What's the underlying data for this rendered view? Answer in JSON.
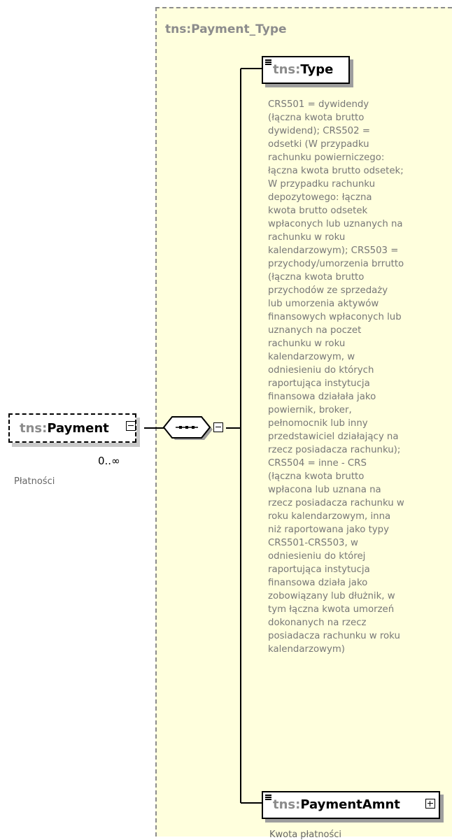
{
  "complex_type": {
    "title": "tns:Payment_Type"
  },
  "root_element": {
    "prefix": "tns:",
    "name": "Payment",
    "occurrence": "0..∞",
    "annotation": "Płatności"
  },
  "sequence_compositor": {
    "icon": "sequence-icon",
    "collapse_icon": "minus-icon"
  },
  "children": [
    {
      "prefix": "tns:",
      "name": "Type",
      "annotation_lines": [
        "CRS501 = dywidendy",
        "(łączna kwota brutto",
        "dywidend); CRS502 =",
        "odsetki (W przypadku",
        "rachunku powierniczego:",
        "łączna kwota brutto odsetek;",
        "W przypadku rachunku",
        "depozytowego: łączna",
        "kwota brutto odsetek",
        "wpłaconych lub uznanych na",
        "rachunku w roku",
        "kalendarzowym); CRS503 =",
        "przychody/umorzenia brrutto",
        "(łączna kwota brutto",
        "przychodów ze sprzedaży",
        "lub umorzenia aktywów",
        "finansowych wpłaconych lub",
        "uznanych na poczet",
        "rachunku w roku",
        "kalendarzowym, w",
        "odniesieniu do których",
        "raportująca instytucja",
        "finansowa działała jako",
        "powiernik, broker,",
        "pełnomocnik lub inny",
        "przedstawiciel działający na",
        "rzecz posiadacza rachunku);",
        "CRS504 = inne - CRS",
        "(łączna kwota brutto",
        "wpłacona lub uznana na",
        "rzecz posiadacza rachunku w",
        "roku kalendarzowym, inna",
        "niż raportowana jako typy",
        "CRS501-CRS503, w",
        "odniesieniu do której",
        "raportująca instytucja",
        "finansowa działa jako",
        "zobowiązany lub dłużnik, w",
        "tym łączna kwota umorzeń",
        "dokonanych na rzecz",
        "posiadacza rachunku w roku",
        "kalendarzowym)"
      ]
    },
    {
      "prefix": "tns:",
      "name": "PaymentAmnt",
      "annotation": "Kwota płatności",
      "expand_icon": "plus-icon"
    }
  ],
  "colors": {
    "type_background": "#ffffdd",
    "dashed_border": "#8c8c8c",
    "prefix_text": "#8c8c8c",
    "annotation_text": "#777777"
  }
}
